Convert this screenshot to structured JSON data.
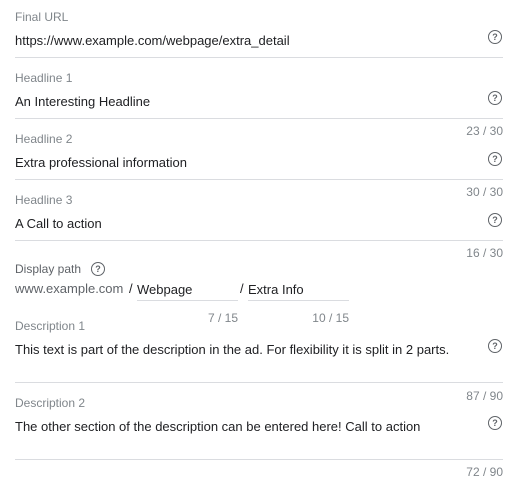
{
  "final_url": {
    "label": "Final URL",
    "value": "https://www.example.com/webpage/extra_detail"
  },
  "headline1": {
    "label": "Headline 1",
    "value": "An Interesting Headline",
    "counter": "23 / 30"
  },
  "headline2": {
    "label": "Headline 2",
    "value": "Extra professional information",
    "counter": "30 / 30"
  },
  "headline3": {
    "label": "Headline 3",
    "value": "A Call to action",
    "counter": "16 / 30"
  },
  "display_path": {
    "label": "Display path",
    "domain": "www.example.com",
    "separator": "/",
    "path1": "Webpage",
    "path1_counter": "7 / 15",
    "path2": "Extra Info",
    "path2_counter": "10 / 15"
  },
  "description1": {
    "label": "Description 1",
    "value": "This text is part of the description in the ad. For flexibility it is split in 2 parts.",
    "counter": "87 / 90"
  },
  "description2": {
    "label": "Description 2",
    "value": "The other section of the description can be entered here! Call to action",
    "counter": "72 / 90"
  },
  "icons": {
    "help": "help-circle-icon",
    "help_glyph": "?"
  }
}
